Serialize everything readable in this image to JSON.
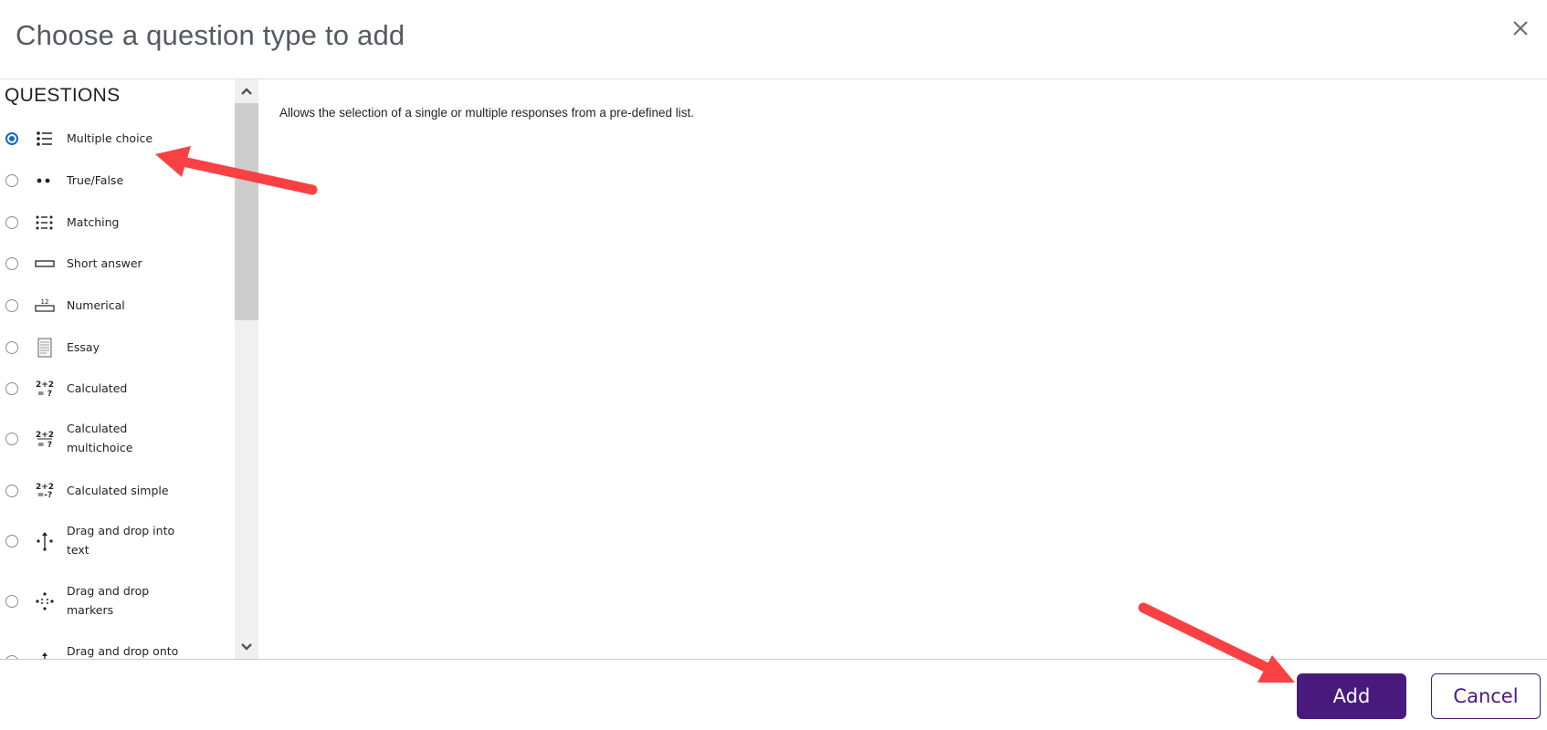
{
  "dialog": {
    "title": "Choose a question type to add",
    "close_icon": "close-icon"
  },
  "sidebar": {
    "section_label": "QUESTIONS",
    "options": [
      {
        "label": "Multiple choice",
        "icon": "multiple-choice-icon",
        "selected": true
      },
      {
        "label": "True/False",
        "icon": "true-false-icon",
        "selected": false
      },
      {
        "label": "Matching",
        "icon": "matching-icon",
        "selected": false
      },
      {
        "label": "Short answer",
        "icon": "short-answer-icon",
        "selected": false
      },
      {
        "label": "Numerical",
        "icon": "numerical-icon",
        "selected": false
      },
      {
        "label": "Essay",
        "icon": "essay-icon",
        "selected": false
      },
      {
        "label": "Calculated",
        "icon": "calculated-icon",
        "selected": false
      },
      {
        "label": "Calculated multichoice",
        "icon": "calculated-multichoice-icon",
        "selected": false
      },
      {
        "label": "Calculated simple",
        "icon": "calculated-simple-icon",
        "selected": false
      },
      {
        "label": "Drag and drop into text",
        "icon": "drag-drop-text-icon",
        "selected": false
      },
      {
        "label": "Drag and drop markers",
        "icon": "drag-drop-markers-icon",
        "selected": false
      },
      {
        "label": "Drag and drop onto image",
        "icon": "drag-drop-image-icon",
        "selected": false
      }
    ]
  },
  "description": "Allows the selection of a single or multiple responses from a pre-defined list.",
  "footer": {
    "add_label": "Add",
    "cancel_label": "Cancel"
  },
  "colors": {
    "primary": "#481a7d",
    "radio_selected": "#0f6cbf",
    "annotation_arrow": "#f94144"
  }
}
